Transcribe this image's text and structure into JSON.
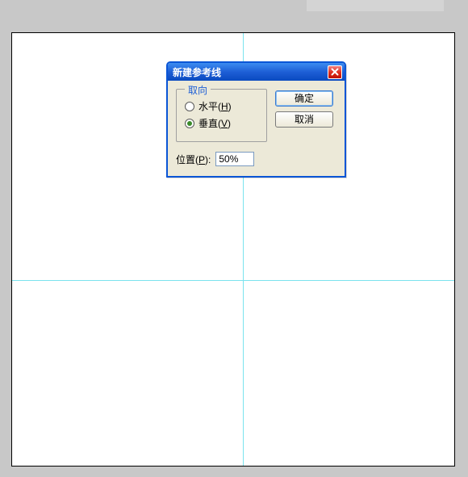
{
  "dialog": {
    "title": "新建参考线",
    "orientation": {
      "legend": "取向",
      "horizontal": "水平(H)",
      "vertical": "垂直(V)",
      "selected": "vertical"
    },
    "position": {
      "label": "位置(P):",
      "value": "50%"
    },
    "buttons": {
      "ok": "确定",
      "cancel": "取消"
    }
  }
}
